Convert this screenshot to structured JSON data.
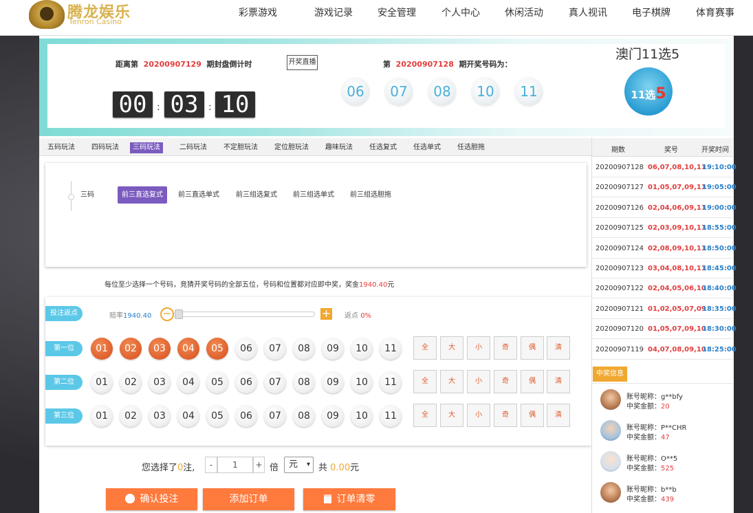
{
  "brand": {
    "title": "腾龙娱乐",
    "subtitle": "Tenron Casino"
  },
  "nav": [
    "彩票游戏",
    "游戏记录",
    "安全管理",
    "个人中心",
    "休闲活动",
    "真人视讯",
    "电子棋牌",
    "体育赛事"
  ],
  "draw": {
    "countdown_prefix": "距离第",
    "countdown_issue": "20200907129",
    "countdown_suffix": "期封盘倒计时",
    "live_button": "开奖直播",
    "hours": "00",
    "minutes": "03",
    "seconds": "10",
    "colon": ":",
    "last_prefix": "第",
    "last_issue": "20200907128",
    "last_suffix": "期开奖号码为：",
    "numbers": [
      "06",
      "07",
      "08",
      "10",
      "11"
    ],
    "game_title": "澳门11选5",
    "game_logo_text": "11选",
    "game_logo_five": "5"
  },
  "tabs": [
    "五码玩法",
    "四码玩法",
    "三码玩法",
    "二码玩法",
    "不定胆玩法",
    "定位胆玩法",
    "趣味玩法",
    "任选复式",
    "任选单式",
    "任选胆拖"
  ],
  "active_tab": 2,
  "sub": {
    "group": "三码",
    "items": [
      "前三直选复式",
      "前三直选单式",
      "前三组选复式",
      "前三组选单式",
      "前三组选胆拖"
    ],
    "active": 0
  },
  "rule_note": "每位至少选择一个号码，竞猜开奖号码的全部五位，号码和位置都对应即中奖，奖金",
  "rule_amount": "1940.40",
  "rule_unit": "元",
  "rebate": {
    "pill": "投注返点",
    "odds_label": "赔率",
    "odds_value": "1940.40",
    "rebate_label": "返点",
    "rebate_value": "0%",
    "minus": "−",
    "plus": "+"
  },
  "positions": [
    {
      "label": "第一位",
      "selected": [
        "01",
        "02",
        "03",
        "04",
        "05"
      ]
    },
    {
      "label": "第二位",
      "selected": []
    },
    {
      "label": "第三位",
      "selected": []
    }
  ],
  "numbers": [
    "01",
    "02",
    "03",
    "04",
    "05",
    "06",
    "07",
    "08",
    "09",
    "10",
    "11"
  ],
  "quick": [
    "全",
    "大",
    "小",
    "奇",
    "偶",
    "清"
  ],
  "summary": {
    "chosen_prefix": "您选择了",
    "chosen_count": "0",
    "chosen_suffix": "注,",
    "step_minus": "-",
    "multiplier": "1",
    "step_plus": "+",
    "times": "倍",
    "unit": "元",
    "total_prefix": "共",
    "total": "0.00",
    "total_unit": "元"
  },
  "actions": {
    "confirm": "确认投注",
    "add": "添加订单",
    "clear": "订单清零"
  },
  "history": {
    "headers": [
      "期数",
      "奖号",
      "开奖时间"
    ],
    "rows": [
      {
        "issue": "20200907128",
        "nums": "06,07,08,10,11",
        "time": "19:10:00"
      },
      {
        "issue": "20200907127",
        "nums": "01,05,07,09,11",
        "time": "19:05:00"
      },
      {
        "issue": "20200907126",
        "nums": "02,04,06,09,11",
        "time": "19:00:00"
      },
      {
        "issue": "20200907125",
        "nums": "02,03,09,10,11",
        "time": "18:55:00"
      },
      {
        "issue": "20200907124",
        "nums": "02,08,09,10,11",
        "time": "18:50:00"
      },
      {
        "issue": "20200907123",
        "nums": "03,04,08,10,11",
        "time": "18:45:00"
      },
      {
        "issue": "20200907122",
        "nums": "02,04,05,06,10",
        "time": "18:40:00"
      },
      {
        "issue": "20200907121",
        "nums": "01,02,05,07,09",
        "time": "18:35:00"
      },
      {
        "issue": "20200907120",
        "nums": "01,05,07,09,10",
        "time": "18:30:00"
      },
      {
        "issue": "20200907119",
        "nums": "04,07,08,09,10",
        "time": "18:25:00"
      }
    ]
  },
  "winners": {
    "title": "中奖信息",
    "name_label": "账号昵称：",
    "amount_label": "中奖金额：",
    "list": [
      {
        "name": "g**bfy",
        "amount": "20"
      },
      {
        "name": "P**CHR",
        "amount": "47"
      },
      {
        "name": "O**5",
        "amount": "525"
      },
      {
        "name": "b**b",
        "amount": "439"
      }
    ]
  },
  "colors": {
    "accent_purple": "#7b5bbf",
    "ball_selected": "#e0602b",
    "button_orange": "#ff7a3d",
    "pill_blue": "#5cc8e8",
    "draw_number": "#49b0d8",
    "history_nums": "#e23d3d",
    "history_time": "#2a7fc8"
  }
}
